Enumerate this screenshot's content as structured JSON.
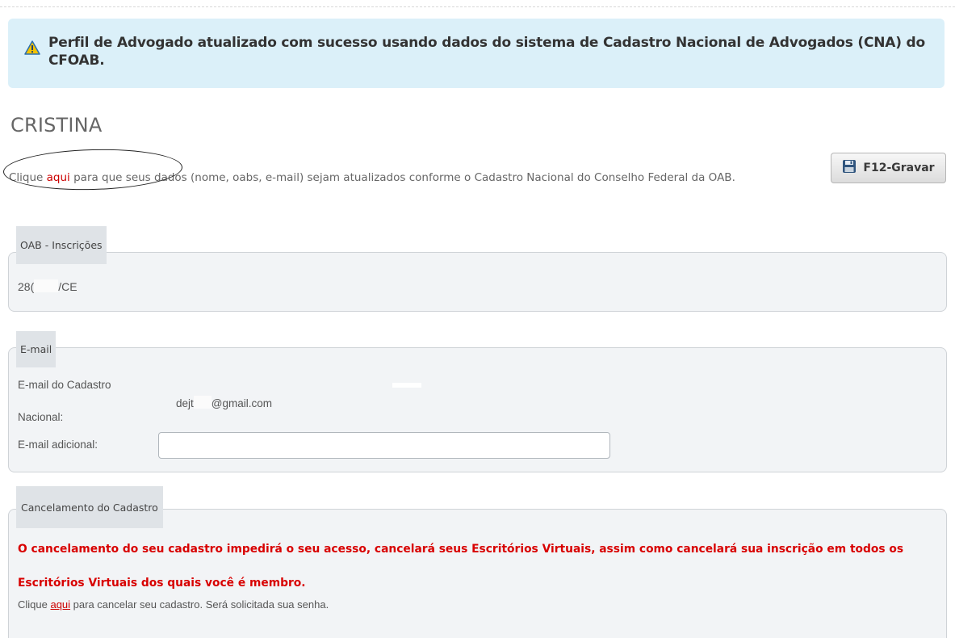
{
  "alert": {
    "icon": "warning-triangle-icon",
    "message": "Perfil de Advogado atualizado com sucesso usando dados do sistema de Cadastro Nacional de Advogados (CNA) do CFOAB."
  },
  "page_title": "CRISTINA",
  "intro": {
    "before_link": "Clique ",
    "link": "aqui",
    "after_link": " para que seus dados (nome, oabs, e-mail) sejam atualizados conforme o Cadastro Nacional do Conselho Federal da OAB."
  },
  "save_button": {
    "icon": "floppy-disk-icon",
    "label": "F12-Gravar"
  },
  "oab_section": {
    "legend": "OAB - Inscrições",
    "value_prefix": "28(",
    "value_suffix": "/CE"
  },
  "email_section": {
    "legend": "E-mail",
    "national_label_line1": "E-mail do Cadastro",
    "national_label_line2": "Nacional:",
    "national_value_prefix": "dejt",
    "national_value_suffix": "@gmail.com",
    "additional_label": "E-mail adicional:",
    "additional_value": ""
  },
  "cancel_section": {
    "legend": "Cancelamento do Cadastro",
    "warning": "O cancelamento do seu cadastro impedirá o seu acesso, cancelará seus Escritórios Virtuais, assim como cancelará sua inscrição em todos os Escritórios Virtuais dos quais você é membro.",
    "before_link": "Clique ",
    "link": "aqui",
    "after_link": " para cancelar seu cadastro. Será solicitada sua senha."
  },
  "colors": {
    "alert_background": "#dbf0f9",
    "warning_red": "#d80000",
    "link_red": "#cc0000",
    "panel_background": "#f2f4f6"
  }
}
